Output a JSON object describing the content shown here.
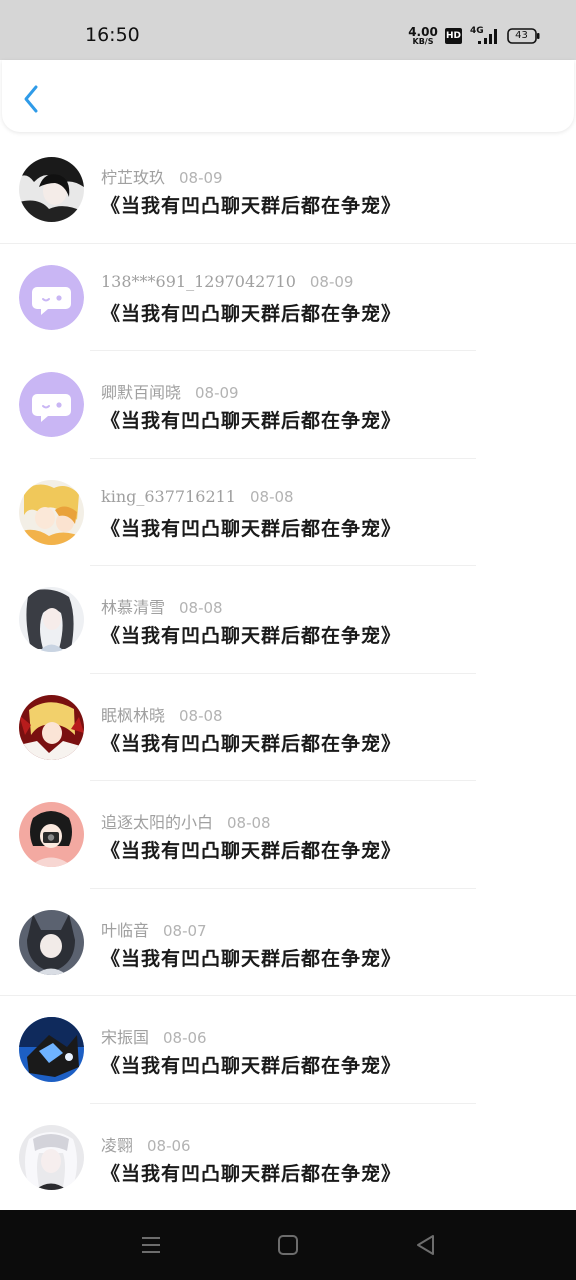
{
  "status_bar": {
    "time": "16:50",
    "net_speed_value": "4.00",
    "net_speed_unit": "KB/S",
    "hd": "HD",
    "network": "4G",
    "battery": "43"
  },
  "header": {
    "back_icon": "chevron-left-icon",
    "accent_color": "#2f9be8"
  },
  "comments": [
    {
      "name": "柠芷玫玖",
      "date": "08-09",
      "text": "《当我有凹凸聊天群后都在争宠》",
      "avatar": "anime-dark"
    },
    {
      "name": "138***691_1297042710",
      "date": "08-09",
      "text": "《当我有凹凸聊天群后都在争宠》",
      "avatar": "default-chat"
    },
    {
      "name": "卿默百闻晓",
      "date": "08-09",
      "text": "《当我有凹凸聊天群后都在争宠》",
      "avatar": "default-chat"
    },
    {
      "name": "king_637716211",
      "date": "08-08",
      "text": "《当我有凹凸聊天群后都在争宠》",
      "avatar": "anime-blonde"
    },
    {
      "name": "林慕清雪",
      "date": "08-08",
      "text": "《当我有凹凸聊天群后都在争宠》",
      "avatar": "anime-gray"
    },
    {
      "name": "眠枫林晓",
      "date": "08-08",
      "text": "《当我有凹凸聊天群后都在争宠》",
      "avatar": "anime-red"
    },
    {
      "name": "追逐太阳的小白",
      "date": "08-08",
      "text": "《当我有凹凸聊天群后都在争宠》",
      "avatar": "anime-pink"
    },
    {
      "name": "叶临音",
      "date": "08-07",
      "text": "《当我有凹凸聊天群后都在争宠》",
      "avatar": "anime-cat"
    },
    {
      "name": "宋振国",
      "date": "08-06",
      "text": "《当我有凹凸聊天群后都在争宠》",
      "avatar": "anime-blue"
    },
    {
      "name": "凌翾",
      "date": "08-06",
      "text": "《当我有凹凸聊天群后都在争宠》",
      "avatar": "anime-white"
    }
  ],
  "nav_bar": {
    "menu_icon": "menu-icon",
    "home_icon": "home-icon",
    "back_icon": "back-triangle-icon"
  }
}
